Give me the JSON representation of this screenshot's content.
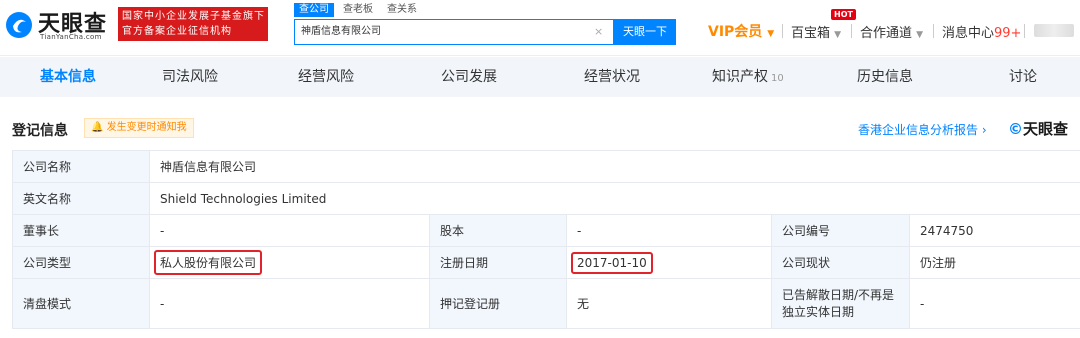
{
  "header": {
    "logo_title": "天眼查",
    "logo_sub": "TianYanCha.com",
    "badge_line1": "国家中小企业发展子基金旗下",
    "badge_line2": "官方备案企业征信机构",
    "search_tabs": [
      "查公司",
      "查老板",
      "查关系"
    ],
    "search_value": "神盾信息有限公司",
    "clear_icon": "×",
    "search_button": "天眼一下",
    "vip": "VIP会员",
    "baibaoxiang": "百宝箱",
    "hot": "HOT",
    "partner": "合作通道",
    "message_center": "消息中心",
    "message_count": "99+"
  },
  "tabs": [
    {
      "label": "基本信息",
      "count": ""
    },
    {
      "label": "司法风险",
      "count": ""
    },
    {
      "label": "经营风险",
      "count": ""
    },
    {
      "label": "公司发展",
      "count": ""
    },
    {
      "label": "经营状况",
      "count": ""
    },
    {
      "label": "知识产权",
      "count": "10"
    },
    {
      "label": "历史信息",
      "count": ""
    },
    {
      "label": "讨论",
      "count": ""
    }
  ],
  "section": {
    "title": "登记信息",
    "notify": "发生变更时通知我",
    "report_link": "香港企业信息分析报告",
    "report_arrow": "›",
    "brand": "天眼查"
  },
  "info": {
    "company_name_label": "公司名称",
    "company_name": "神盾信息有限公司",
    "english_name_label": "英文名称",
    "english_name": "Shield Technologies Limited",
    "chairman_label": "董事长",
    "chairman": "-",
    "equity_label": "股本",
    "equity": "-",
    "company_no_label": "公司编号",
    "company_no": "2474750",
    "company_type_label": "公司类型",
    "company_type": "私人股份有限公司",
    "reg_date_label": "注册日期",
    "reg_date": "2017-01-10",
    "status_label": "公司现状",
    "status": "仍注册",
    "liquidation_label": "清盘模式",
    "liquidation": "-",
    "charge_reg_label": "押记登记册",
    "charge_reg": "无",
    "dissolve_label": "已告解散日期/不再是独立实体日期",
    "dissolve": "-"
  },
  "colors": {
    "accent": "#0084ff",
    "brand_red": "#d71a1b",
    "vip_orange": "#ff8a00",
    "highlight_red": "#e0242b"
  }
}
